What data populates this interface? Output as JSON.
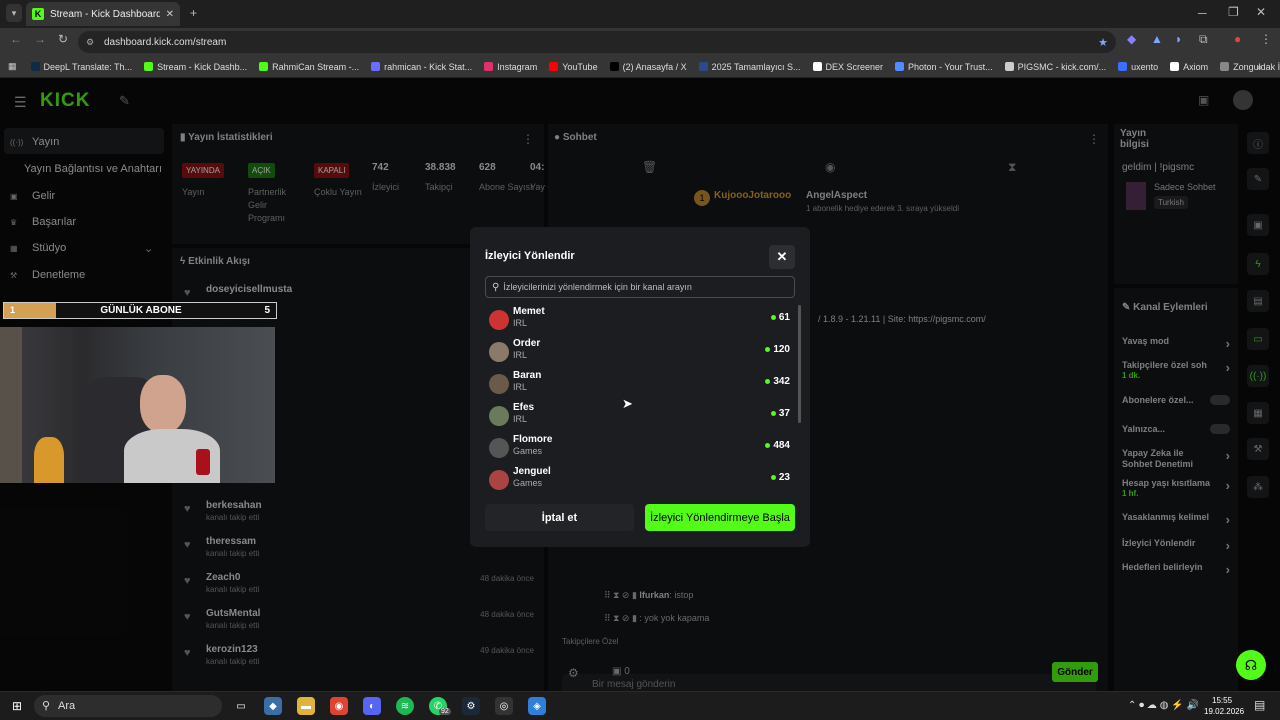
{
  "browser": {
    "tab_title": "Stream - Kick Dashboard",
    "url": "dashboard.kick.com/stream",
    "bookmarks": [
      {
        "label": "DeepL Translate: Th...",
        "color": "#0f2b46"
      },
      {
        "label": "Stream - Kick Dashb...",
        "color": "#53fc18"
      },
      {
        "label": "RahmiCan Stream -...",
        "color": "#53fc18"
      },
      {
        "label": "rahmican - Kick Stat...",
        "color": "#6c6cff"
      },
      {
        "label": "Instagram",
        "color": "#e1306c"
      },
      {
        "label": "YouTube",
        "color": "#ff0000"
      },
      {
        "label": "(2) Anasayfa / X",
        "color": "#000000"
      },
      {
        "label": "2025 Tamamlayıcı S...",
        "color": "#2a4a8a"
      },
      {
        "label": "DEX Screener",
        "color": "#ffffff"
      },
      {
        "label": "Photon - Your Trust...",
        "color": "#4f8cff"
      },
      {
        "label": "PIGSMC - kick.com/...",
        "color": "#cccccc"
      },
      {
        "label": "uxento",
        "color": "#3d6cff"
      },
      {
        "label": "Axiom",
        "color": "#ffffff"
      },
      {
        "label": "Zonguldak İngilizce...",
        "color": "#888888"
      }
    ]
  },
  "app": {
    "logo": "KICK",
    "sidebar": [
      {
        "label": "Yayın",
        "icon": "broadcast-icon"
      },
      {
        "label": "Yayın Bağlantısı ve Anahtarı",
        "icon": ""
      },
      {
        "label": "Gelir",
        "icon": "wallet-icon"
      },
      {
        "label": "Başarılar",
        "icon": "trophy-icon"
      },
      {
        "label": "Stüdyo",
        "icon": "studio-icon"
      },
      {
        "label": "Denetleme",
        "icon": "hammer-icon"
      }
    ],
    "stats": {
      "title": "Yayın İstatistikleri",
      "items": [
        {
          "badge": "YAYINDA",
          "label": "Yayın"
        },
        {
          "badge": "AÇIK",
          "label": "Partnerlik Gelir Programı"
        },
        {
          "badge": "KAPALI",
          "label": "Çoklu Yayın"
        },
        {
          "value": "742",
          "label": "İzleyici"
        },
        {
          "value": "38.838",
          "label": "Takipçi"
        },
        {
          "value": "628",
          "label": "Abone Sayısı"
        },
        {
          "value": "04:",
          "label": "Yay Old Sür"
        }
      ]
    },
    "activity": {
      "title": "Etkinlik Akışı",
      "items": [
        {
          "name": "doseyicisellmusta",
          "sub": "",
          "time": ""
        },
        {
          "name": "berkesahan",
          "sub": "kanalı takip etti",
          "time": ""
        },
        {
          "name": "theressam",
          "sub": "kanalı takip etti",
          "time": ""
        },
        {
          "name": "Zeach0",
          "sub": "kanalı takip etti",
          "time": "48 dakika önce"
        },
        {
          "name": "GutsMental",
          "sub": "kanalı takip etti",
          "time": "48 dakika önce"
        },
        {
          "name": "kerozin123",
          "sub": "kanalı takip etti",
          "time": "49 dakika önce"
        }
      ]
    },
    "chat": {
      "title": "Sohbet",
      "gift_user1": "KujoooJotarooo",
      "gift_user2": "AngelAspect",
      "gift_text": "1 abonelik hediye ederek 3. sıraya yükseldi",
      "pinned": "/ 1.8.9 - 1.21.11 | Site: https://pigsmc.com/",
      "messages": [
        {
          "user": "Ifurkan",
          "text": ": istop"
        },
        {
          "user": "",
          "text": ": yok yok kapama"
        }
      ],
      "followers_only": "Takipçilere Özel",
      "input_placeholder": "Bir mesaj gönderin",
      "send": "Gönder",
      "viewer_count": "0"
    },
    "stream_info": {
      "title": "Yayın bilgisi",
      "stream_title": "geldim | !pigsmc",
      "category": "Sadece Sohbet",
      "language": "Turkish"
    },
    "channel_actions": {
      "title": "Kanal Eylemleri",
      "items": [
        {
          "label": "Yavaş mod",
          "sub": ""
        },
        {
          "label": "Takipçilere özel soh",
          "sub": "1 dk."
        },
        {
          "label": "Abonelere özel...",
          "sub": ""
        },
        {
          "label": "Yalnızca...",
          "sub": ""
        },
        {
          "label": "Yapay Zeka ile Sohbet Denetimi",
          "sub": ""
        },
        {
          "label": "Hesap yaşı kısıtlama",
          "sub": "1 hf."
        },
        {
          "label": "Yasaklanmış kelimel",
          "sub": ""
        },
        {
          "label": "İzleyici Yönlendir",
          "sub": ""
        },
        {
          "label": "Hedefleri belirleyin",
          "sub": ""
        }
      ]
    }
  },
  "overlay": {
    "abone_left": "1",
    "abone_label": "GÜNLÜK ABONE",
    "abone_right": "5"
  },
  "modal": {
    "title": "İzleyici Yönlendir",
    "search_placeholder": "İzleyicilerinizi yönlendirmek için bir kanal arayın",
    "channels": [
      {
        "name": "Memet",
        "category": "IRL",
        "viewers": "61"
      },
      {
        "name": "Order",
        "category": "IRL",
        "viewers": "120"
      },
      {
        "name": "Baran",
        "category": "IRL",
        "viewers": "342"
      },
      {
        "name": "Efes",
        "category": "IRL",
        "viewers": "37"
      },
      {
        "name": "Flomore",
        "category": "Games",
        "viewers": "484"
      },
      {
        "name": "Jenguel",
        "category": "Games",
        "viewers": "23"
      }
    ],
    "cancel": "İptal et",
    "start": "İzleyici Yönlendirmeye Başla"
  },
  "taskbar": {
    "search": "Ara",
    "time": "15:55",
    "date": "19.02.2026",
    "whatsapp_badge": "92"
  }
}
